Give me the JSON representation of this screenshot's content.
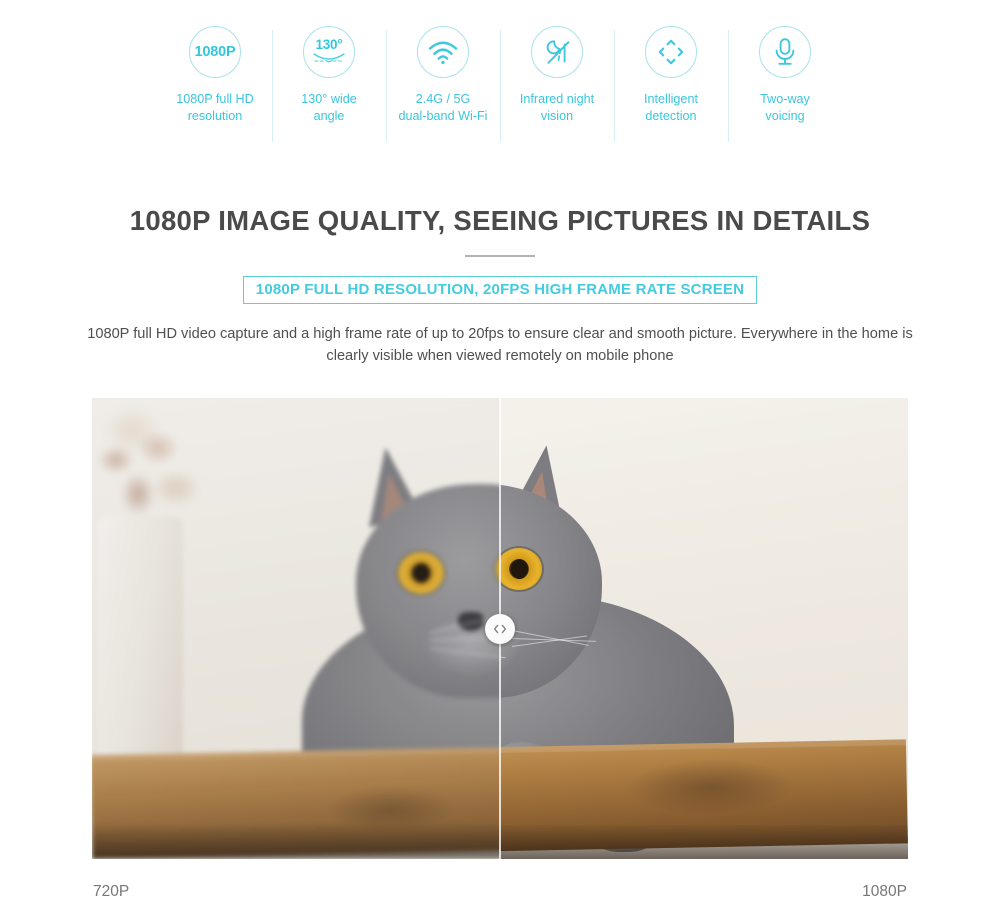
{
  "features": [
    {
      "icon": "1080p-badge-icon",
      "icon_text": "1080P",
      "label": "1080P full HD\nresolution",
      "label_line1": "1080P full HD",
      "label_line2": "resolution"
    },
    {
      "icon": "wide-angle-lens-icon",
      "icon_text": "130°",
      "label": "130° wide angle",
      "label_line1": "130° wide",
      "label_line2": "angle"
    },
    {
      "icon": "wifi-icon",
      "icon_text": "",
      "label": "2.4G / 5G dual-band Wi-Fi",
      "label_line1": "2.4G / 5G",
      "label_line2": "dual-band Wi-Fi"
    },
    {
      "icon": "night-vision-moon-icon",
      "icon_text": "",
      "label": "Infrared night vision",
      "label_line1": "Infrared night",
      "label_line2": "vision"
    },
    {
      "icon": "four-direction-arrows-icon",
      "icon_text": "",
      "label": "Intelligent detection",
      "label_line1": "Intelligent",
      "label_line2": "detection"
    },
    {
      "icon": "microphone-icon",
      "icon_text": "",
      "label": "Two-way voicing",
      "label_line1": "Two-way",
      "label_line2": "voicing"
    }
  ],
  "main": {
    "headline": "1080P IMAGE QUALITY, SEEING PICTURES IN DETAILS",
    "badge": "1080P FULL HD RESOLUTION, 20FPS HIGH FRAME RATE SCREEN",
    "description": "1080P full HD video capture and a high frame rate of up to 20fps to ensure clear and smooth picture. Everywhere in the home is clearly visible when viewed remotely on mobile phone"
  },
  "comparison": {
    "left_label": "720P",
    "right_label": "1080P",
    "handle_icon": "left-right-chevron-icon",
    "split_position_percent": 50,
    "image_subject": "gray british shorthair cat on wooden plank against white brick wall"
  },
  "colors": {
    "accent_cyan": "#3ac6de",
    "icon_border": "#a8e2ec",
    "headline_gray": "#4a4a4a",
    "body_gray": "#4f4f4f",
    "label_gray": "#777777",
    "divider": "#d6eef4",
    "rule": "#b4b4b4"
  }
}
